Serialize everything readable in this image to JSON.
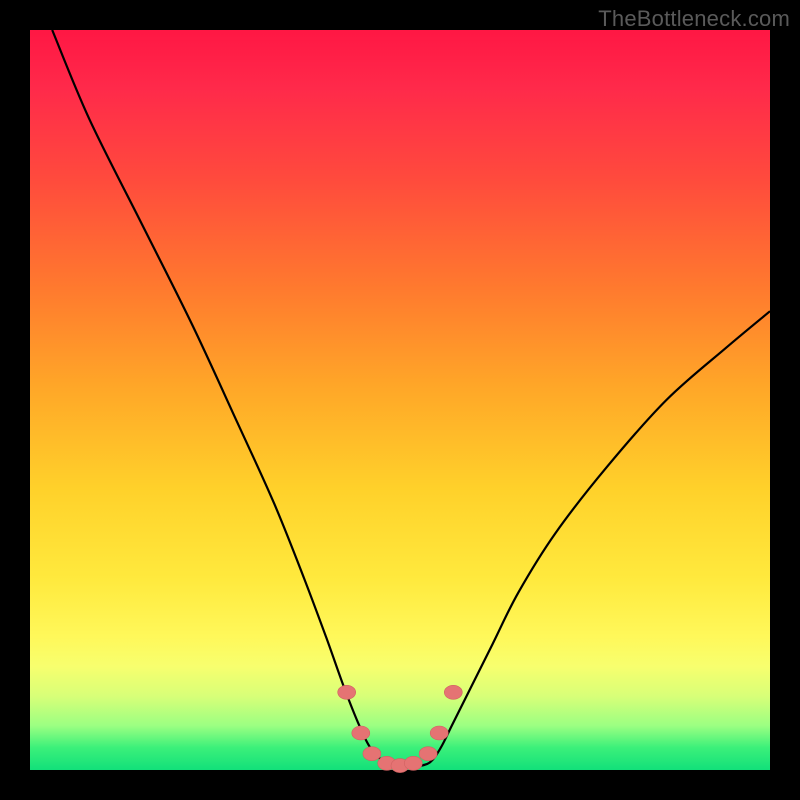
{
  "watermark": "TheBottleneck.com",
  "colors": {
    "frame": "#000000",
    "gradient_top": "#ff1744",
    "gradient_mid": "#ffd12a",
    "gradient_bottom": "#12e07a",
    "curve": "#000000",
    "marker_fill": "#e57373"
  },
  "chart_data": {
    "type": "line",
    "title": "",
    "xlabel": "",
    "ylabel": "",
    "xlim": [
      0,
      100
    ],
    "ylim": [
      0,
      100
    ],
    "grid": false,
    "legend": false,
    "series": [
      {
        "name": "bottleneck-curve",
        "x": [
          3,
          8,
          15,
          22,
          28,
          33,
          37,
          40,
          42.5,
          44.5,
          46,
          48,
          50,
          52,
          54,
          55.5,
          57,
          59.5,
          62.5,
          66,
          71,
          78,
          86,
          94,
          100
        ],
        "y": [
          100,
          88,
          74,
          60,
          47,
          36,
          26,
          18,
          11,
          6,
          3,
          1,
          0.5,
          0.5,
          1,
          3,
          6,
          11,
          17,
          24,
          32,
          41,
          50,
          57,
          62
        ]
      }
    ],
    "markers": {
      "name": "highlight-dots",
      "x": [
        42.8,
        44.7,
        46.2,
        48.2,
        50.0,
        51.8,
        53.8,
        55.3,
        57.2
      ],
      "y": [
        10.5,
        5.0,
        2.2,
        0.9,
        0.6,
        0.9,
        2.2,
        5.0,
        10.5
      ]
    }
  }
}
